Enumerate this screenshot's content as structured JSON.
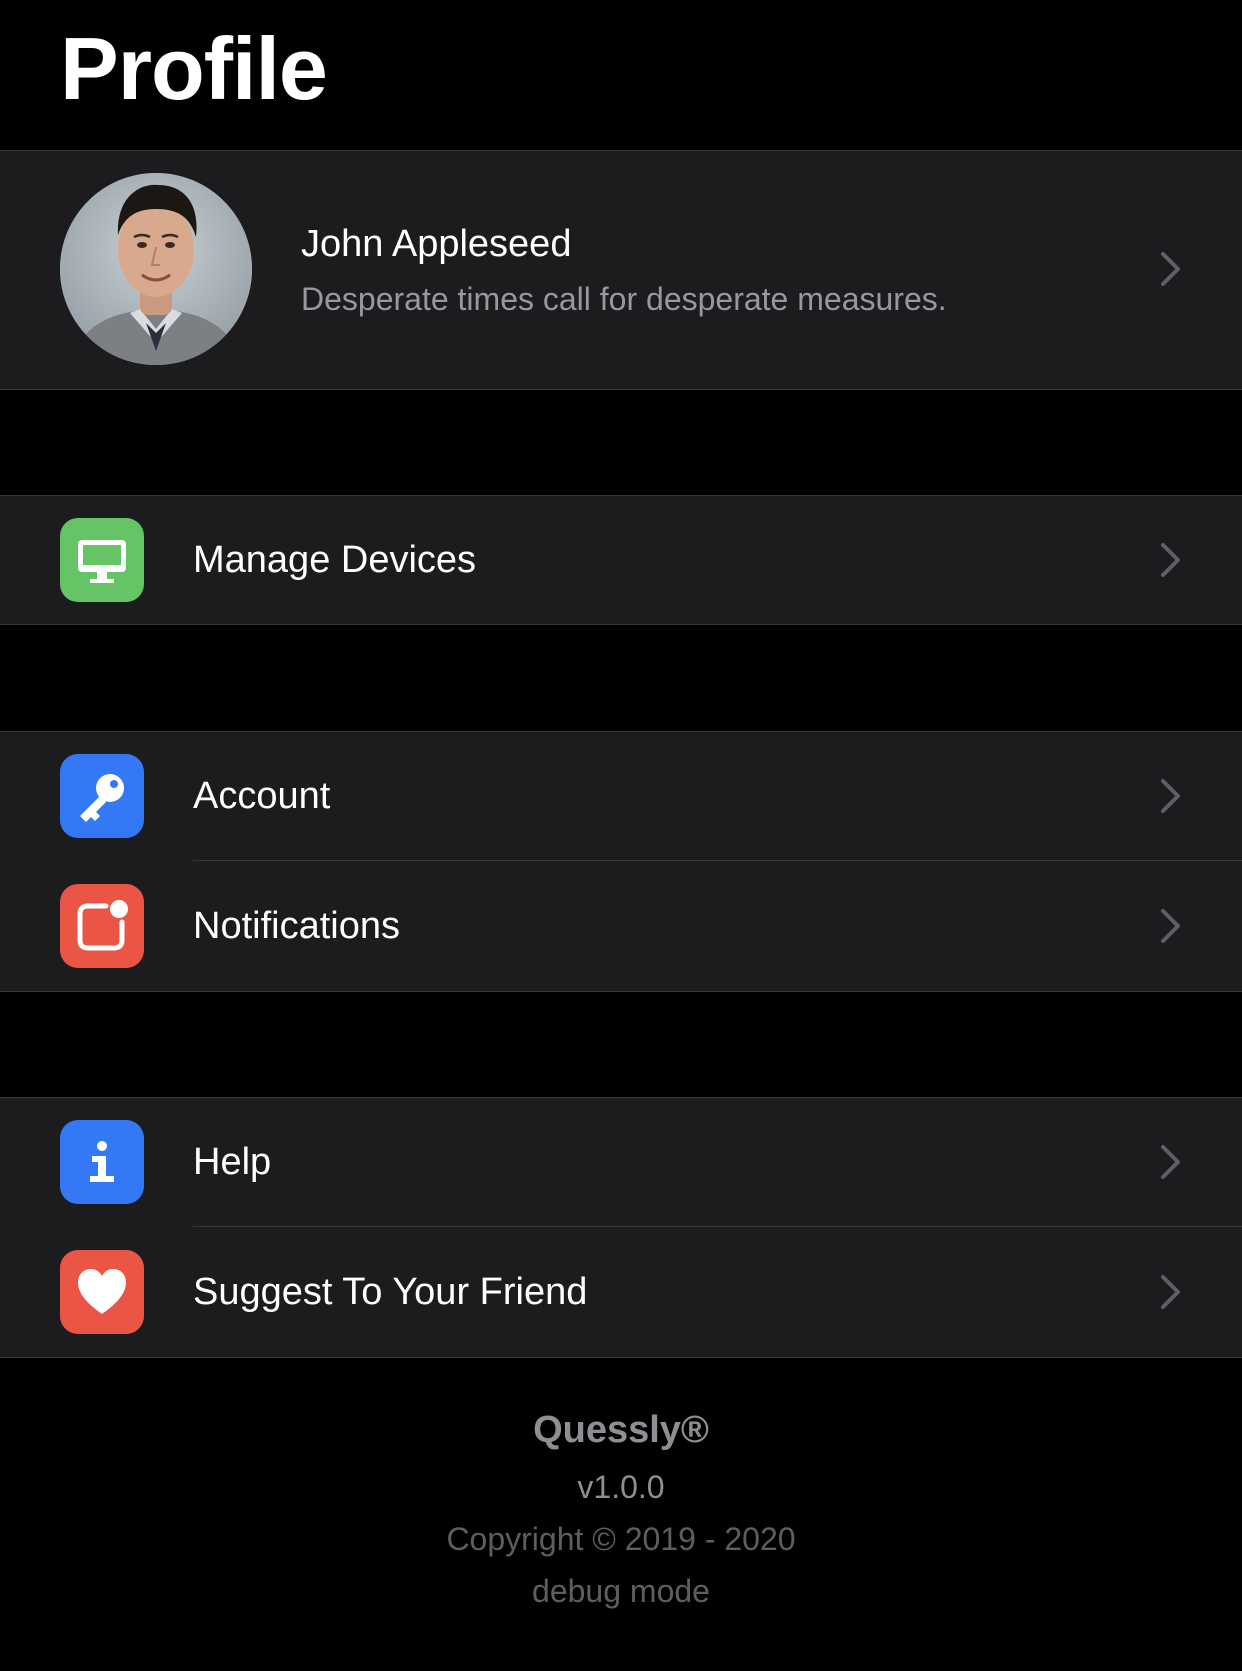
{
  "header": {
    "title": "Profile"
  },
  "profile": {
    "name": "John Appleseed",
    "status": "Desperate times call for desperate measures.",
    "avatar_icon": "user-photo",
    "chevron_icon": "chevron-right-icon"
  },
  "groups": [
    {
      "rows": [
        {
          "label": "Manage Devices",
          "icon": "desktop-icon",
          "icon_color": "#65c466"
        }
      ]
    },
    {
      "rows": [
        {
          "label": "Account",
          "icon": "key-icon",
          "icon_color": "#3478f6"
        },
        {
          "label": "Notifications",
          "icon": "notification-badge-icon",
          "icon_color": "#eb5545"
        }
      ]
    },
    {
      "rows": [
        {
          "label": "Help",
          "icon": "info-icon",
          "icon_color": "#3478f6"
        },
        {
          "label": "Suggest To Your Friend",
          "icon": "heart-icon",
          "icon_color": "#eb5545"
        }
      ]
    }
  ],
  "footer": {
    "brand": "Quessly®",
    "version": "v1.0.0",
    "copyright": "Copyright © 2019 - 2020",
    "mode": "debug mode"
  },
  "colors": {
    "background": "#000000",
    "cell_background": "#1c1c1e",
    "separator": "#38383a",
    "secondary_text": "#98989d",
    "chevron": "#5f5f64"
  }
}
